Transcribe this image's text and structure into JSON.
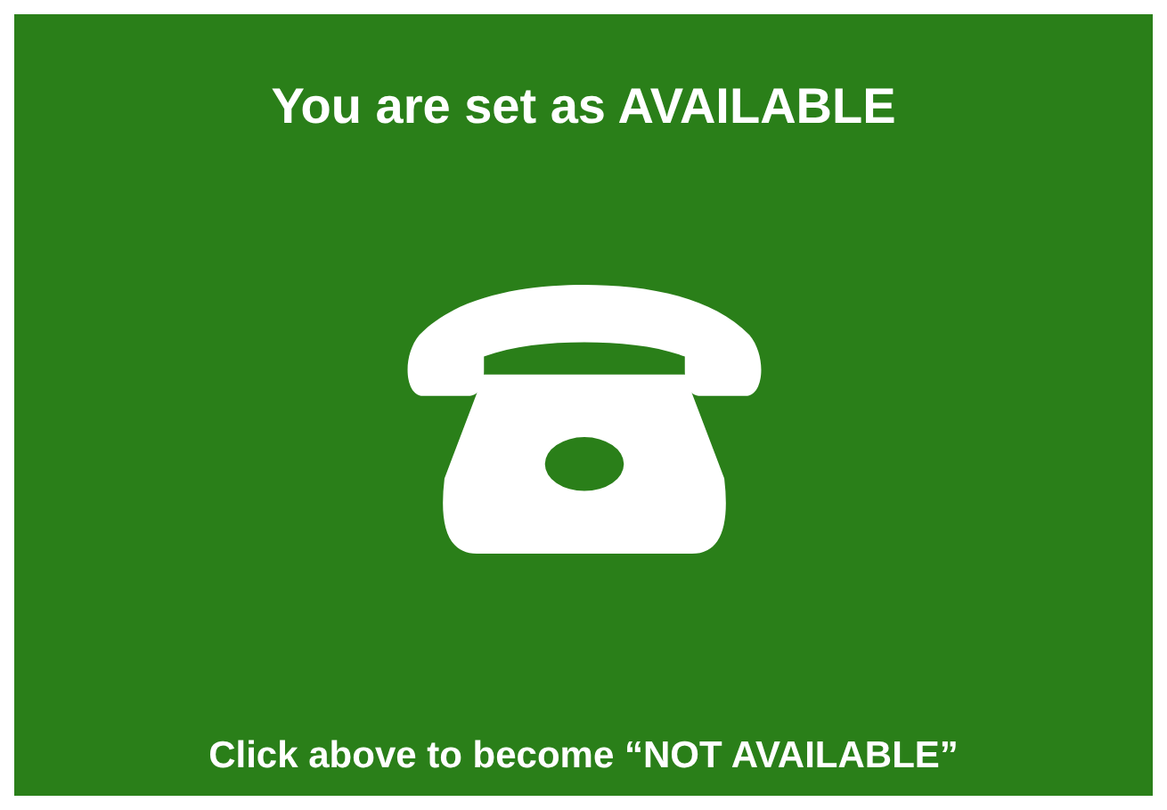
{
  "status": {
    "title": "You are set as AVAILABLE",
    "available": true
  },
  "hint": "Click above to become “NOT AVAILABLE”"
}
